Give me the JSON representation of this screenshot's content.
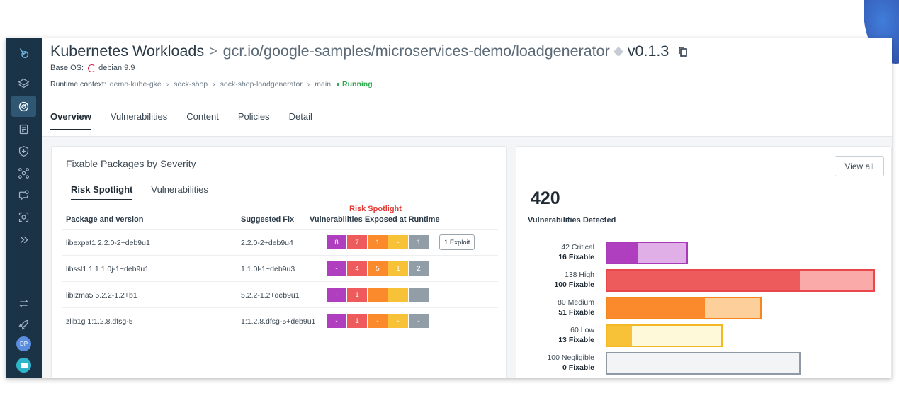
{
  "header": {
    "title": "Kubernetes Workloads",
    "separator": ">",
    "image_path": "gcr.io/google-samples/microservices-demo/loadgenerator",
    "version": "v0.1.3",
    "base_os_label": "Base OS:",
    "base_os_value": "debian 9.9",
    "runtime_label": "Runtime context:",
    "runtime_crumbs": [
      "demo-kube-gke",
      "sock-shop",
      "sock-shop-loadgenerator",
      "main"
    ],
    "runtime_status": "Running",
    "tabs": [
      "Overview",
      "Vulnerabilities",
      "Content",
      "Policies",
      "Detail"
    ],
    "active_tab": "Overview"
  },
  "sidebar": {
    "icons": [
      "logo-icon",
      "layers-icon",
      "radar-icon",
      "report-icon",
      "shield-icon",
      "network-icon",
      "chat-alert-icon",
      "scan-icon",
      "expand-icon",
      "swap-icon",
      "rocket-icon"
    ],
    "avatar_initials": "DP"
  },
  "fixable_card": {
    "title": "Fixable Packages by Severity",
    "subtabs": [
      "Risk Spotlight",
      "Vulnerabilities"
    ],
    "risk_label": "Risk Spotlight",
    "columns": {
      "package": "Package and version",
      "fix": "Suggested Fix",
      "vulns": "Vulnerabilities Exposed at Runtime"
    },
    "severity_colors": [
      "#b03fc0",
      "#ef5a5c",
      "#fb8a2c",
      "#f7c238",
      "#919ea8"
    ],
    "rows": [
      {
        "package": "libexpat1 2.2.0-2+deb9u1",
        "fix": "2.2.0-2+deb9u4",
        "counts": [
          "8",
          "7",
          "1",
          "-",
          "1"
        ],
        "exploit": "1 Exploit"
      },
      {
        "package": "libssl1.1 1.1.0j-1~deb9u1",
        "fix": "1.1.0l-1~deb9u3",
        "counts": [
          "-",
          "4",
          "5",
          "1",
          "2"
        ],
        "exploit": ""
      },
      {
        "package": "liblzma5 5.2.2-1.2+b1",
        "fix": "5.2.2-1.2+deb9u1",
        "counts": [
          "-",
          "1",
          "-",
          "-",
          "-"
        ],
        "exploit": ""
      },
      {
        "package": "zlib1g 1:1.2.8.dfsg-5",
        "fix": "1:1.2.8.dfsg-5+deb9u1",
        "counts": [
          "-",
          "1",
          "-",
          "-",
          "-"
        ],
        "exploit": ""
      }
    ]
  },
  "summary_card": {
    "view_all": "View all",
    "total": "420",
    "total_label": "Vulnerabilities Detected",
    "levels": [
      {
        "label": "42 Critical",
        "fixable": "16 Fixable",
        "total": 42,
        "fixed": 16,
        "color": "#b03fc0",
        "light": "#e0afe8",
        "border": "#a93ab8"
      },
      {
        "label": "138 High",
        "fixable": "100 Fixable",
        "total": 138,
        "fixed": 100,
        "color": "#ee5b5d",
        "light": "#fbaaaa",
        "border": "#e8484b"
      },
      {
        "label": "80 Medium",
        "fixable": "51 Fixable",
        "total": 80,
        "fixed": 51,
        "color": "#fb8a2c",
        "light": "#fdcf9a",
        "border": "#f7851f"
      },
      {
        "label": "60 Low",
        "fixable": "13 Fixable",
        "total": 60,
        "fixed": 13,
        "color": "#f7c238",
        "light": "#fef9d8",
        "border": "#f3b824"
      },
      {
        "label": "100 Negligible",
        "fixable": "0 Fixable",
        "total": 100,
        "fixed": 0,
        "color": "#c5cdd4",
        "light": "#f3f4f6",
        "border": "#8d9aa5"
      }
    ]
  }
}
